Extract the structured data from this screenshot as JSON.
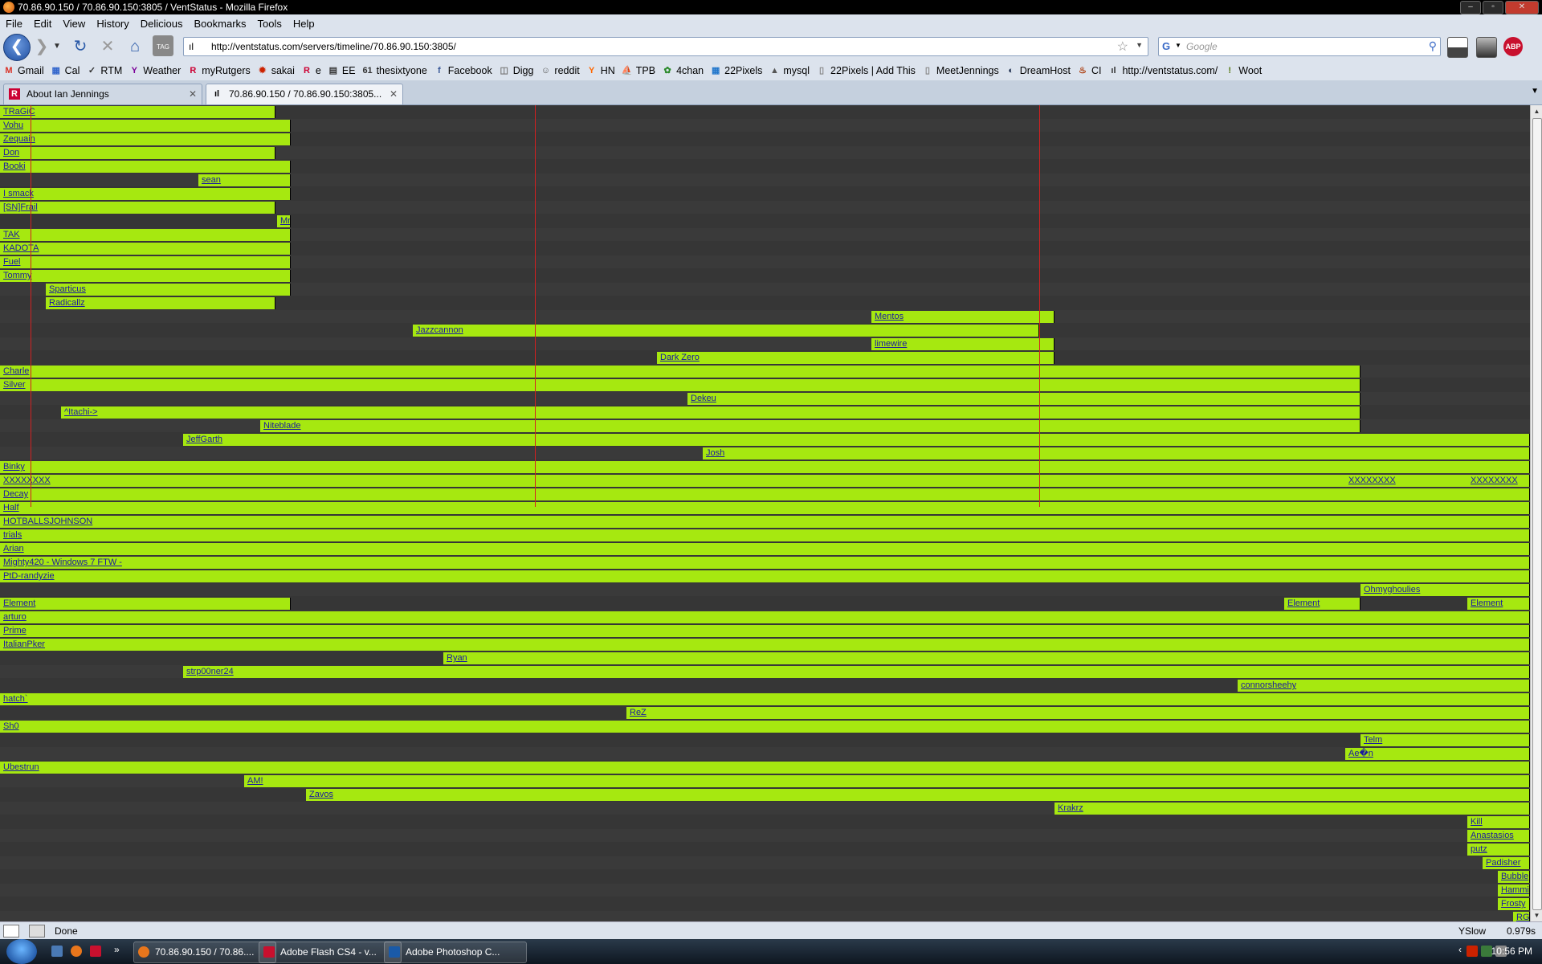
{
  "window": {
    "title": "70.86.90.150 / 70.86.90.150:3805 / VentStatus - Mozilla Firefox"
  },
  "menu": [
    "File",
    "Edit",
    "View",
    "History",
    "Delicious",
    "Bookmarks",
    "Tools",
    "Help"
  ],
  "address": {
    "url": "http://ventstatus.com/servers/timeline/70.86.90.150:3805/"
  },
  "search": {
    "placeholder": "Google"
  },
  "bookmarks": [
    {
      "label": "Gmail",
      "icon": "gmail-icon",
      "color": "#d93025",
      "glyph": "M"
    },
    {
      "label": "Cal",
      "icon": "calendar-icon",
      "color": "#3366cc",
      "glyph": "▦"
    },
    {
      "label": "RTM",
      "icon": "rtm-icon",
      "color": "#333",
      "glyph": "✓"
    },
    {
      "label": "Weather",
      "icon": "yahoo-icon",
      "color": "#7b0099",
      "glyph": "Y"
    },
    {
      "label": "myRutgers",
      "icon": "rutgers-icon",
      "color": "#cc0033",
      "glyph": "R"
    },
    {
      "label": "sakai",
      "icon": "sakai-icon",
      "color": "#cc2200",
      "glyph": "✹"
    },
    {
      "label": "e",
      "icon": "rutgers-icon",
      "color": "#cc0033",
      "glyph": "R"
    },
    {
      "label": "EE",
      "icon": "ee-icon",
      "color": "#333",
      "glyph": "▤"
    },
    {
      "label": "thesixtyone",
      "icon": "sixtyone-icon",
      "color": "#333",
      "glyph": "61"
    },
    {
      "label": "Facebook",
      "icon": "facebook-icon",
      "color": "#3b5998",
      "glyph": "f"
    },
    {
      "label": "Digg",
      "icon": "digg-icon",
      "color": "#777",
      "glyph": "◫"
    },
    {
      "label": "reddit",
      "icon": "reddit-icon",
      "color": "#555",
      "glyph": "☺"
    },
    {
      "label": "HN",
      "icon": "hn-icon",
      "color": "#ff6600",
      "glyph": "Y"
    },
    {
      "label": "TPB",
      "icon": "tpb-icon",
      "color": "#333",
      "glyph": "⛵"
    },
    {
      "label": "4chan",
      "icon": "fourchan-icon",
      "color": "#2a8a2a",
      "glyph": "✿"
    },
    {
      "label": "22Pixels",
      "icon": "pixels-icon",
      "color": "#2277cc",
      "glyph": "▦"
    },
    {
      "label": "mysql",
      "icon": "mysql-icon",
      "color": "#555",
      "glyph": "▲"
    },
    {
      "label": "22Pixels | Add This",
      "icon": "page-icon",
      "color": "#888",
      "glyph": "▯"
    },
    {
      "label": "MeetJennings",
      "icon": "page-icon",
      "color": "#888",
      "glyph": "▯"
    },
    {
      "label": "DreamHost",
      "icon": "dreamhost-icon",
      "color": "#112244",
      "glyph": "◐"
    },
    {
      "label": "CI",
      "icon": "ci-icon",
      "color": "#aa3300",
      "glyph": "♨"
    },
    {
      "label": "http://ventstatus.com/",
      "icon": "ventstatus-icon",
      "color": "#333",
      "glyph": "ıl"
    },
    {
      "label": "Woot",
      "icon": "woot-icon",
      "color": "#557711",
      "glyph": "!"
    }
  ],
  "tabs": [
    {
      "label": "About Ian Jennings",
      "icon": "rutgers-icon"
    },
    {
      "label": "70.86.90.150 / 70.86.90.150:3805...",
      "icon": "ventstatus-icon"
    }
  ],
  "timeline": {
    "line_color": "#d42020",
    "bar_color": "#a6e810",
    "rows": [
      {
        "bars": [
          {
            "name": "TRaGiC",
            "start": 0,
            "end": 343
          }
        ]
      },
      {
        "bars": [
          {
            "name": "Vohu",
            "start": 0,
            "end": 362
          }
        ]
      },
      {
        "bars": [
          {
            "name": "Zequain",
            "start": 0,
            "end": 362
          }
        ]
      },
      {
        "bars": [
          {
            "name": "Don",
            "start": 0,
            "end": 343
          }
        ]
      },
      {
        "bars": [
          {
            "name": "Booki",
            "start": 0,
            "end": 362
          }
        ]
      },
      {
        "bars": [
          {
            "name": "sean",
            "start": 247,
            "end": 362
          }
        ]
      },
      {
        "bars": [
          {
            "name": "I smack",
            "start": 0,
            "end": 362
          }
        ]
      },
      {
        "bars": [
          {
            "name": "[SN]Frail",
            "start": 0,
            "end": 343
          }
        ]
      },
      {
        "bars": [
          {
            "name": "Mr",
            "start": 345,
            "end": 362
          }
        ]
      },
      {
        "bars": [
          {
            "name": "TAK",
            "start": 0,
            "end": 362
          }
        ]
      },
      {
        "bars": [
          {
            "name": "KADOTA",
            "start": 0,
            "end": 362
          }
        ]
      },
      {
        "bars": [
          {
            "name": "Fuel",
            "start": 0,
            "end": 362
          }
        ]
      },
      {
        "bars": [
          {
            "name": "Tommy",
            "start": 0,
            "end": 362
          }
        ]
      },
      {
        "bars": [
          {
            "name": "Sparticus",
            "start": 57,
            "end": 362
          }
        ]
      },
      {
        "bars": [
          {
            "name": "Radicallz",
            "start": 57,
            "end": 343
          }
        ]
      },
      {
        "bars": [
          {
            "name": "Mentos",
            "start": 1085,
            "end": 1313
          }
        ]
      },
      {
        "bars": [
          {
            "name": "Jazzcannon",
            "start": 514,
            "end": 1294
          }
        ]
      },
      {
        "bars": [
          {
            "name": "limewire",
            "start": 1085,
            "end": 1313
          }
        ]
      },
      {
        "bars": [
          {
            "name": "Dark Zero",
            "start": 818,
            "end": 1313
          }
        ]
      },
      {
        "bars": [
          {
            "name": "Charle",
            "start": 0,
            "end": 1694
          }
        ]
      },
      {
        "bars": [
          {
            "name": "Silver",
            "start": 0,
            "end": 1694
          }
        ]
      },
      {
        "bars": [
          {
            "name": "Dekeu",
            "start": 856,
            "end": 1694
          }
        ]
      },
      {
        "bars": [
          {
            "name": "^Itachi->",
            "start": 76,
            "end": 1694
          }
        ]
      },
      {
        "bars": [
          {
            "name": "Niteblade",
            "start": 324,
            "end": 1694
          }
        ]
      },
      {
        "bars": [
          {
            "name": "JeffGarth",
            "start": 228,
            "end": 1905
          }
        ]
      },
      {
        "bars": [
          {
            "name": "Josh",
            "start": 875,
            "end": 1905
          }
        ]
      },
      {
        "bars": [
          {
            "name": "Binky",
            "start": 0,
            "end": 1905
          }
        ]
      },
      {
        "bars": [
          {
            "name": "XXXXXXXX",
            "start": 0,
            "end": 1905
          },
          {
            "name": "XXXXXXXX",
            "start": 1675,
            "end": 1905,
            "overlay": true
          },
          {
            "name": "XXXXXXXX",
            "start": 1827,
            "end": 1905,
            "overlay": true
          }
        ]
      },
      {
        "bars": [
          {
            "name": "Decay",
            "start": 0,
            "end": 1905
          }
        ]
      },
      {
        "bars": [
          {
            "name": "Half",
            "start": 0,
            "end": 1905
          }
        ]
      },
      {
        "bars": [
          {
            "name": "HOTBALLSJOHNSON",
            "start": 0,
            "end": 1905
          }
        ]
      },
      {
        "bars": [
          {
            "name": "trials",
            "start": 0,
            "end": 1905
          }
        ]
      },
      {
        "bars": [
          {
            "name": "Arian",
            "start": 0,
            "end": 1905
          }
        ]
      },
      {
        "bars": [
          {
            "name": "Mighty420 - Windows 7 FTW -",
            "start": 0,
            "end": 1905
          }
        ]
      },
      {
        "bars": [
          {
            "name": "PtD-randyzie",
            "start": 0,
            "end": 1905
          }
        ]
      },
      {
        "bars": [
          {
            "name": "Ohmyghoulies",
            "start": 1694,
            "end": 1905
          }
        ]
      },
      {
        "bars": [
          {
            "name": "Element",
            "start": 0,
            "end": 362
          },
          {
            "name": "Element",
            "start": 1599,
            "end": 1694
          },
          {
            "name": "Element",
            "start": 1827,
            "end": 1905
          }
        ]
      },
      {
        "bars": [
          {
            "name": "arturo",
            "start": 0,
            "end": 1905
          }
        ]
      },
      {
        "bars": [
          {
            "name": "Prime",
            "start": 0,
            "end": 1905
          }
        ]
      },
      {
        "bars": [
          {
            "name": "ItalianPker",
            "start": 0,
            "end": 1905
          }
        ]
      },
      {
        "bars": [
          {
            "name": "Ryan",
            "start": 552,
            "end": 1905
          }
        ]
      },
      {
        "bars": [
          {
            "name": "strp00ner24",
            "start": 228,
            "end": 1905
          }
        ]
      },
      {
        "bars": [
          {
            "name": "connorsheehy",
            "start": 1541,
            "end": 1905
          }
        ]
      },
      {
        "bars": [
          {
            "name": "hatch`",
            "start": 0,
            "end": 1905
          }
        ]
      },
      {
        "bars": [
          {
            "name": "ReZ",
            "start": 780,
            "end": 1905
          }
        ]
      },
      {
        "bars": [
          {
            "name": "Sh0",
            "start": 0,
            "end": 1905
          }
        ]
      },
      {
        "bars": [
          {
            "name": "Telm",
            "start": 1694,
            "end": 1905
          }
        ]
      },
      {
        "bars": [
          {
            "name": "Ae�n",
            "start": 1675,
            "end": 1905
          }
        ]
      },
      {
        "bars": [
          {
            "name": "Ubestrun",
            "start": 0,
            "end": 1905
          }
        ]
      },
      {
        "bars": [
          {
            "name": "AM!",
            "start": 304,
            "end": 1905
          }
        ]
      },
      {
        "bars": [
          {
            "name": "Zavos",
            "start": 381,
            "end": 1905
          }
        ]
      },
      {
        "bars": [
          {
            "name": "Krakrz",
            "start": 1313,
            "end": 1905
          }
        ]
      },
      {
        "bars": [
          {
            "name": "Kill",
            "start": 1827,
            "end": 1905
          }
        ]
      },
      {
        "bars": [
          {
            "name": "Anastasios",
            "start": 1827,
            "end": 1905
          }
        ]
      },
      {
        "bars": [
          {
            "name": "putz",
            "start": 1827,
            "end": 1905
          }
        ]
      },
      {
        "bars": [
          {
            "name": "Padisher",
            "start": 1846,
            "end": 1905
          }
        ]
      },
      {
        "bars": [
          {
            "name": "Bubble",
            "start": 1865,
            "end": 1905
          }
        ]
      },
      {
        "bars": [
          {
            "name": "Hammi",
            "start": 1865,
            "end": 1905
          }
        ]
      },
      {
        "bars": [
          {
            "name": "Frosty",
            "start": 1865,
            "end": 1905
          }
        ]
      },
      {
        "bars": [
          {
            "name": "RG",
            "start": 1884,
            "end": 1905
          }
        ]
      }
    ]
  },
  "status": {
    "text": "Done",
    "yslow": "YSlow",
    "time": "0.979s"
  },
  "taskbar": {
    "items": [
      {
        "label": "70.86.90.150 / 70.86....",
        "color": "#e8761c"
      },
      {
        "label": "Adobe Flash CS4 - v...",
        "color": "#c8102e"
      },
      {
        "label": "Adobe Photoshop C...",
        "color": "#1a5aa8"
      }
    ],
    "clock": "10:56 PM"
  }
}
